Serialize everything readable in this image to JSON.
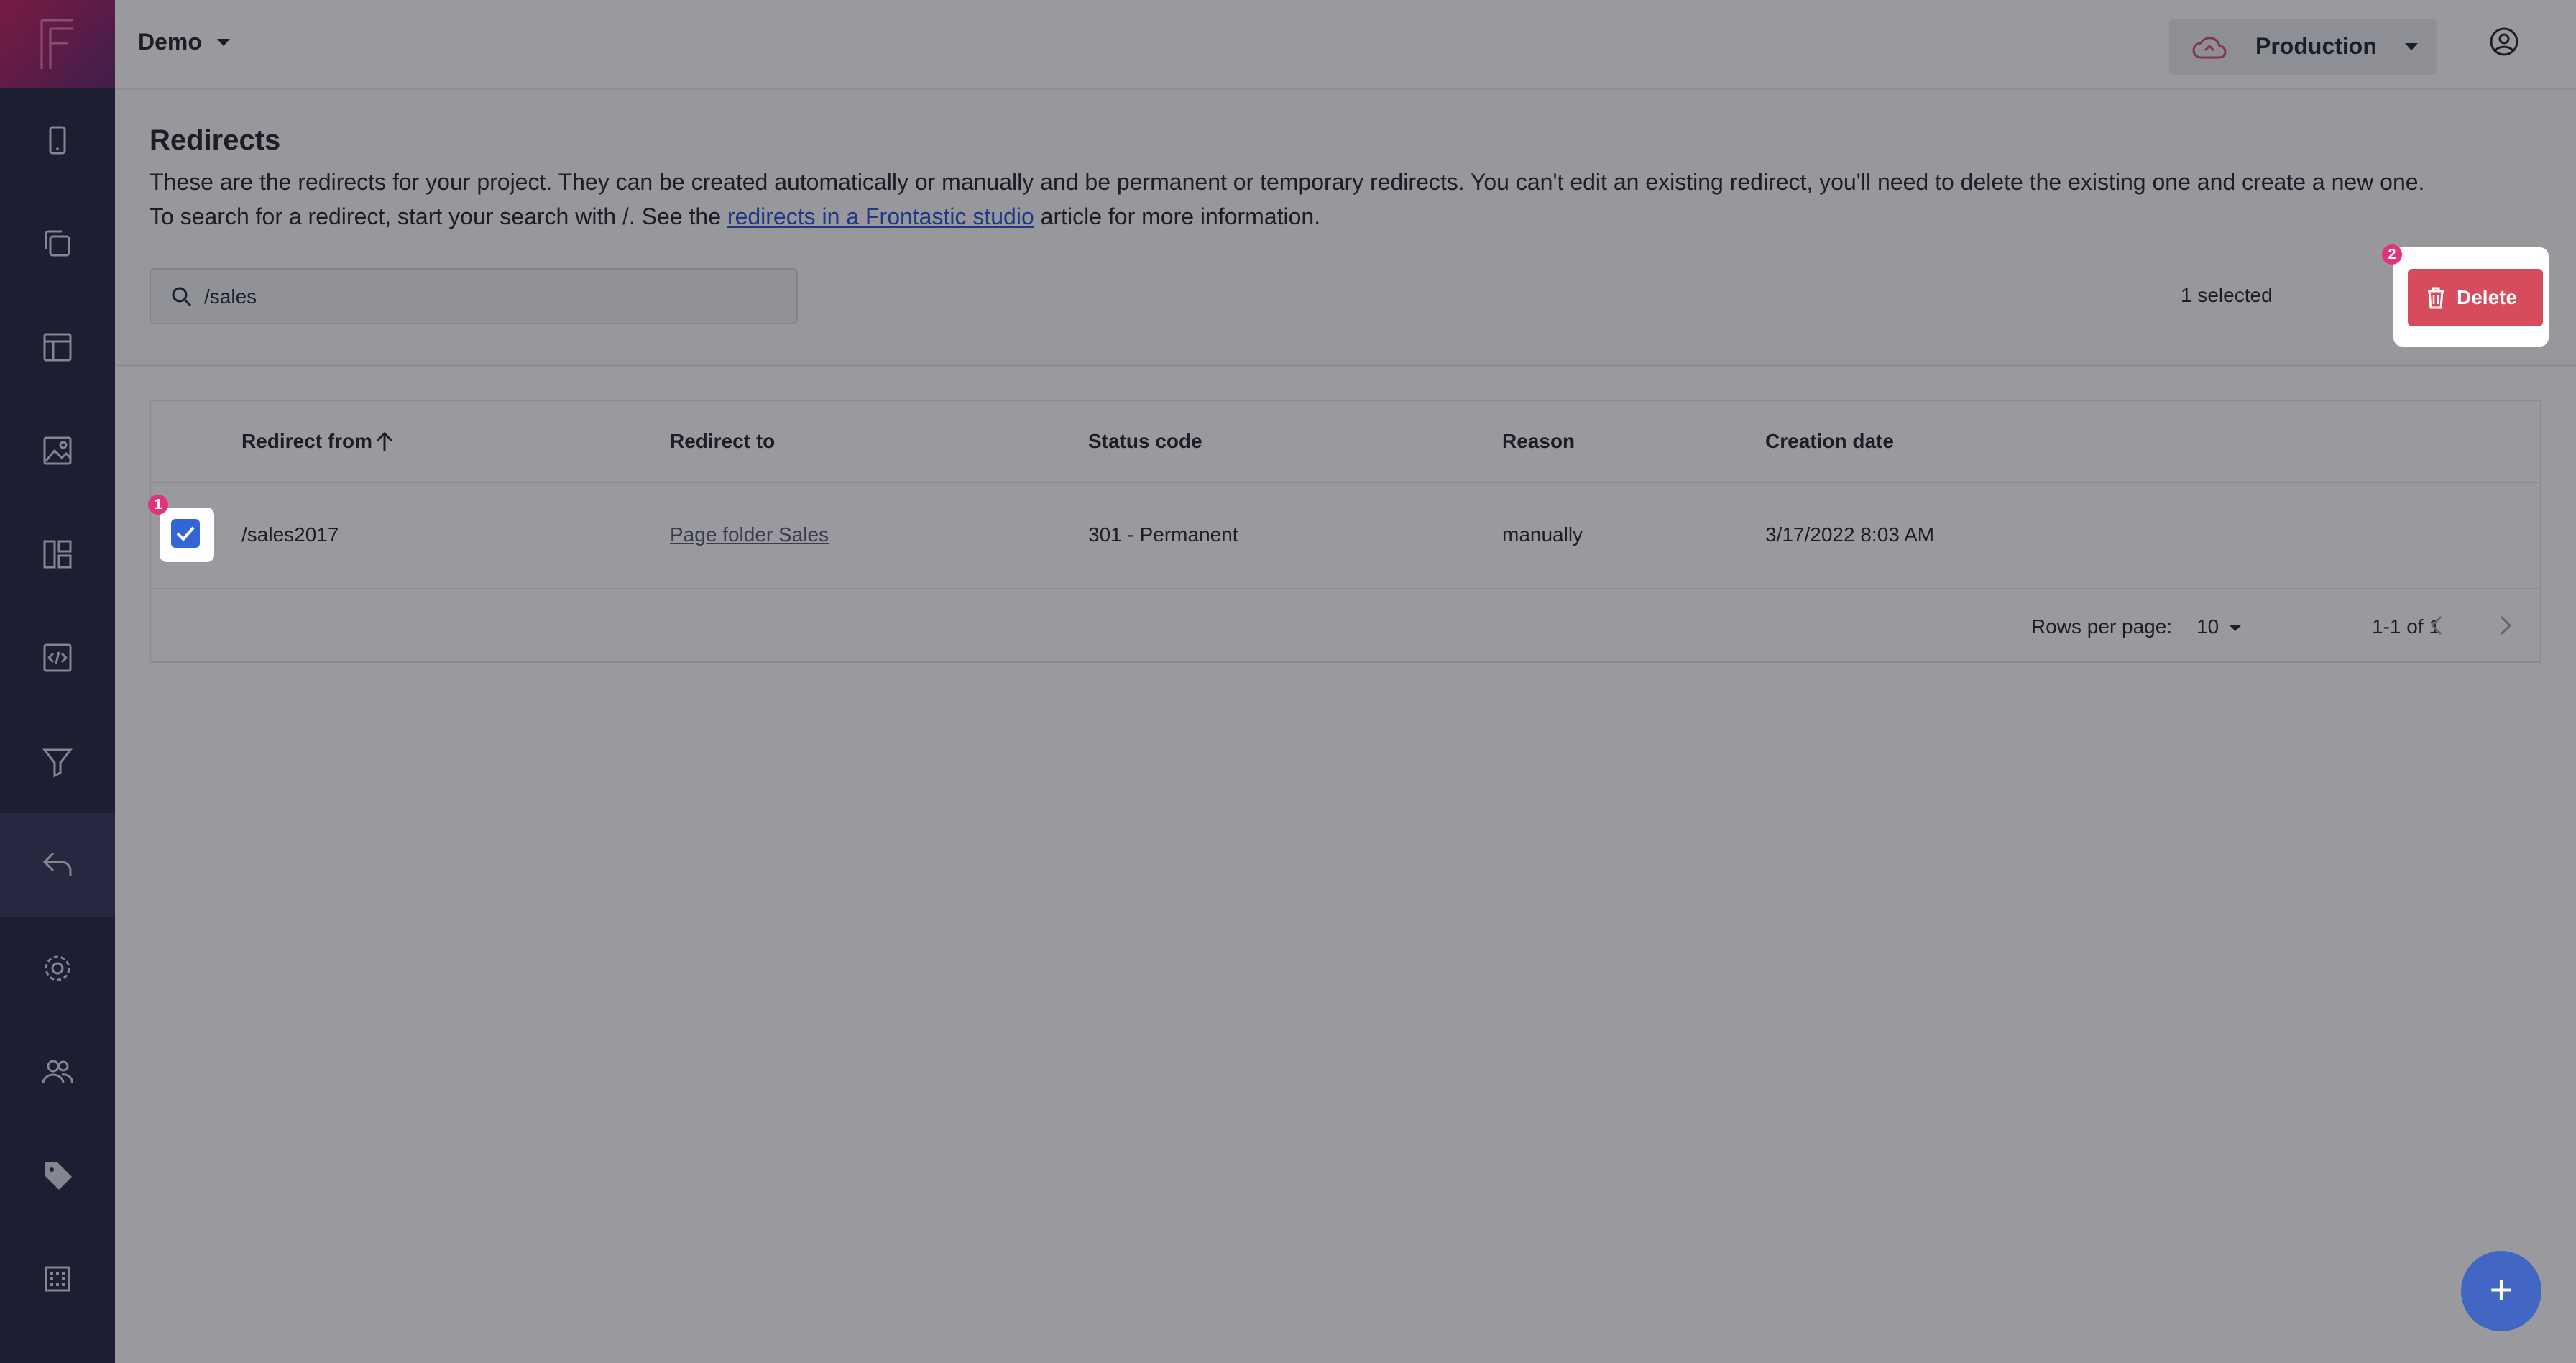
{
  "app": {
    "project_name": "Demo",
    "environment": "Production",
    "brand_color": "#c2185b"
  },
  "sidebar": {
    "items": [
      {
        "icon": "mobile-icon"
      },
      {
        "icon": "copy-pages-icon"
      },
      {
        "icon": "layout-icon"
      },
      {
        "icon": "media-icon"
      },
      {
        "icon": "dashboard-icon"
      },
      {
        "icon": "code-icon"
      },
      {
        "icon": "filter-icon"
      },
      {
        "icon": "redirect-icon",
        "active": true
      },
      {
        "icon": "settings-icon"
      },
      {
        "icon": "users-icon"
      },
      {
        "icon": "tag-icon"
      },
      {
        "icon": "grid-icon"
      }
    ]
  },
  "header": {
    "title": "Redirects",
    "description_line1": "These are the redirects for your project. They can be created automatically or manually and be permanent or temporary redirects. You can't edit an existing redirect, you'll need to delete the existing one and create a new one.",
    "description_line2_prefix": "To search for a redirect, start your search with /. See the ",
    "description_link": "redirects in a Frontastic studio",
    "description_line2_suffix": " article for more information.",
    "search_value": "/sales",
    "selected_count": "1 selected",
    "delete_label": "Delete",
    "delete_color": "#d64c5c"
  },
  "badges": {
    "checkbox": "1",
    "delete": "2"
  },
  "table": {
    "columns": [
      "Redirect from",
      "Redirect to",
      "Status code",
      "Reason",
      "Creation date"
    ],
    "rows": [
      {
        "selected": true,
        "from": "/sales2017",
        "to": "Page folder Sales",
        "status": "301 - Permanent",
        "reason": "manually",
        "created": "3/17/2022 8:03 AM"
      }
    ],
    "rows_per_page_label": "Rows per page:",
    "rows_per_page_value": "10",
    "range": "1-1 of 1"
  },
  "fab": {
    "label": "+"
  }
}
